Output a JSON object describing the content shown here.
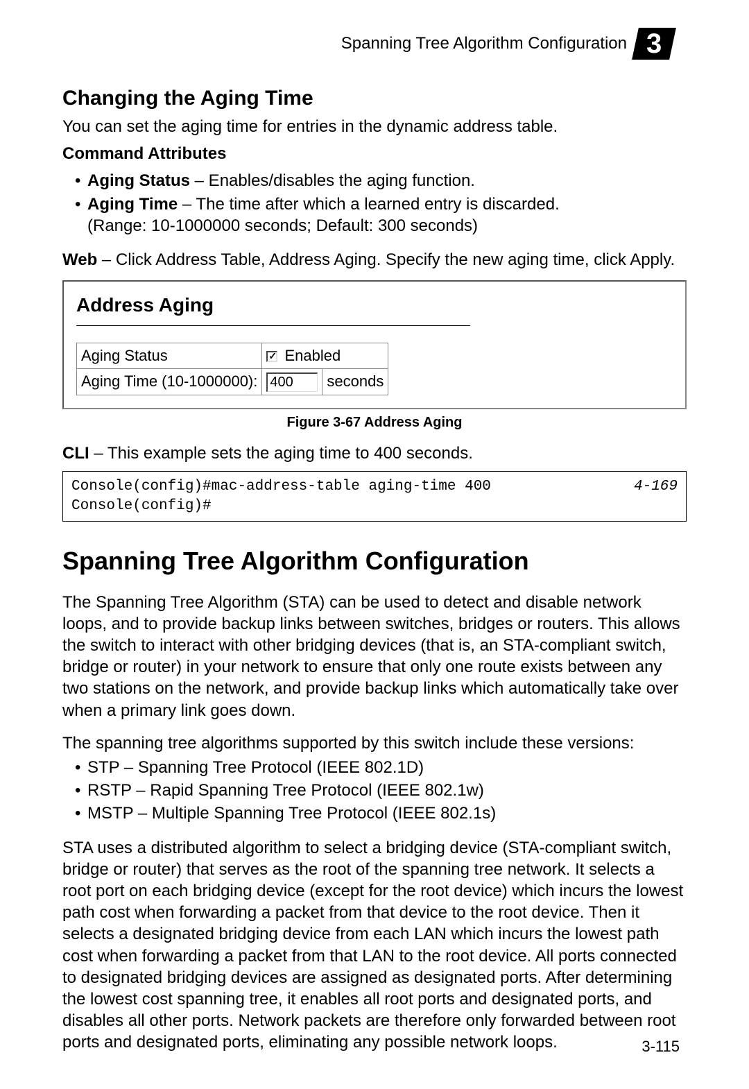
{
  "header": {
    "text": "Spanning Tree Algorithm Configuration",
    "chapter": "3"
  },
  "section1": {
    "title": "Changing the Aging Time",
    "intro": "You can set the aging time for entries in the dynamic address table.",
    "cmdAttrTitle": "Command Attributes",
    "bullets": {
      "a": {
        "bold": "Aging Status",
        "rest": " – Enables/disables the aging function."
      },
      "b": {
        "bold": "Aging Time",
        "rest": " – The time after which a learned entry is discarded.",
        "sub": "(Range: 10-1000000 seconds; Default: 300 seconds)"
      }
    },
    "webBold": "Web",
    "webRest": " – Click Address Table, Address Aging. Specify the new aging time, click Apply."
  },
  "screenshot": {
    "panelTitle": "Address Aging",
    "row1Label": "Aging Status",
    "row1Enabled": " Enabled",
    "row2Label": "Aging Time (10-1000000):",
    "row2Value": "400",
    "row2Unit": "seconds"
  },
  "figCaption": "Figure 3-67   Address Aging",
  "cli": {
    "bold": "CLI",
    "rest": " – This example sets the aging time to 400 seconds.",
    "console": "Console(config)#mac-address-table aging-time 400\nConsole(config)#",
    "ref": "4-169"
  },
  "section2": {
    "title": "Spanning Tree Algorithm Configuration",
    "p1": "The Spanning Tree Algorithm (STA) can be used to detect and disable network loops, and to provide backup links between switches, bridges or routers. This allows the switch to interact with other bridging devices (that is, an STA-compliant switch, bridge or router) in your network to ensure that only one route exists between any two stations on the network, and provide backup links which automatically take over when a primary link goes down.",
    "p2": "The spanning tree algorithms supported by this switch include these versions:",
    "listA": "STP – Spanning Tree Protocol (IEEE 802.1D)",
    "listB": "RSTP – Rapid Spanning Tree Protocol (IEEE 802.1w)",
    "listC": "MSTP – Multiple Spanning Tree Protocol (IEEE 802.1s)",
    "p3": "STA uses a distributed algorithm to select a bridging device (STA-compliant switch, bridge or router) that serves as the root of the spanning tree network. It selects a root port on each bridging device (except for the root device) which incurs the lowest path cost when forwarding a packet from that device to the root device. Then it selects a designated bridging device from each LAN which incurs the lowest path cost when forwarding a packet from that LAN to the root device. All ports connected to designated bridging devices are assigned as designated ports. After determining the lowest cost spanning tree, it enables all root ports and designated ports, and disables all other ports. Network packets are therefore only forwarded between root ports and designated ports, eliminating any possible network loops."
  },
  "footer": "3-115"
}
